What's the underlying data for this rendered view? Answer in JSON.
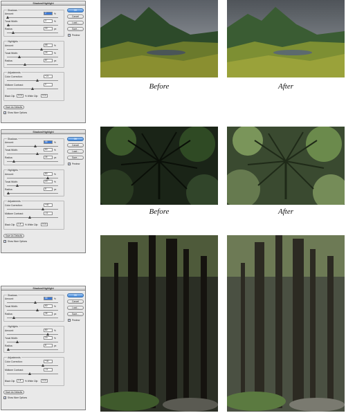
{
  "dialogs": [
    {
      "title": "Shadow/Highlight",
      "shadows": {
        "heading": "Shadows",
        "amount": {
          "label": "Amount:",
          "value": "2",
          "unit": "%",
          "level": 0.02
        },
        "tonal_width": {
          "label": "Tonal Width:",
          "value": "3",
          "unit": "%",
          "level": 0.03
        },
        "radius": {
          "label": "Radius:",
          "value": "30",
          "unit": "px",
          "level": 0.12
        }
      },
      "highlights": {
        "heading": "Highlights",
        "amount": {
          "label": "Amount:",
          "value": "68",
          "unit": "%",
          "level": 0.68
        },
        "tonal_width": {
          "label": "Tonal Width:",
          "value": "24",
          "unit": "%",
          "level": 0.24
        },
        "radius": {
          "label": "Radius:",
          "value": "87",
          "unit": "px",
          "level": 0.35
        }
      },
      "adjustments": {
        "heading": "Adjustments",
        "color_correction": {
          "label": "Color Correction:",
          "value": "+21",
          "level": 0.6
        },
        "midtone_contrast": {
          "label": "Midtone Contrast:",
          "value": "0",
          "level": 0.5
        },
        "black_clip": {
          "label": "Black Clip:",
          "value": "0.01"
        },
        "white_clip": {
          "label": "% White Clip:",
          "value": "0.01"
        }
      },
      "buttons": {
        "ok": "OK",
        "cancel": "Cancel",
        "load": "Load...",
        "save": "Save..."
      },
      "preview": "Preview",
      "save_defaults": "Save As Defaults",
      "show_more": "Show More Options"
    },
    {
      "title": "Shadow/Highlight",
      "shadows": {
        "heading": "Shadows",
        "amount": {
          "label": "Amount:",
          "value": "55",
          "unit": "%",
          "level": 0.55
        },
        "tonal_width": {
          "label": "Tonal Width:",
          "value": "60",
          "unit": "%",
          "level": 0.6
        },
        "radius": {
          "label": "Radius:",
          "value": "34",
          "unit": "px",
          "level": 0.14
        }
      },
      "highlights": {
        "heading": "Highlights",
        "amount": {
          "label": "Amount:",
          "value": "80",
          "unit": "%",
          "level": 0.8
        },
        "tonal_width": {
          "label": "Tonal Width:",
          "value": "20",
          "unit": "%",
          "level": 0.2
        },
        "radius": {
          "label": "Radius:",
          "value": "8",
          "unit": "px",
          "level": 0.03
        }
      },
      "adjustments": {
        "heading": "Adjustments",
        "color_correction": {
          "label": "Color Correction:",
          "value": "+40",
          "level": 0.7
        },
        "midtone_contrast": {
          "label": "Midtone Contrast:",
          "value": "-11",
          "level": 0.45
        },
        "black_clip": {
          "label": "Black Clip:",
          "value": "1.8"
        },
        "white_clip": {
          "label": "% White Clip:",
          "value": "0.01"
        }
      },
      "buttons": {
        "ok": "OK",
        "cancel": "Cancel",
        "load": "Load...",
        "save": "Save..."
      },
      "preview": "Preview",
      "save_defaults": "Save As Defaults",
      "show_more": "Show More Options"
    },
    {
      "title": "Shadow/Highlight",
      "shadows": {
        "heading": "Shadows",
        "amount": {
          "label": "Amount:",
          "value": "55",
          "unit": "%",
          "level": 0.55
        },
        "tonal_width": {
          "label": "Tonal Width:",
          "value": "60",
          "unit": "%",
          "level": 0.6
        },
        "radius": {
          "label": "Radius:",
          "value": "34",
          "unit": "px",
          "level": 0.14
        }
      },
      "highlights": {
        "heading": "Highlights",
        "amount": {
          "label": "Amount:",
          "value": "80",
          "unit": "%",
          "level": 0.8
        },
        "tonal_width": {
          "label": "Tonal Width:",
          "value": "20",
          "unit": "%",
          "level": 0.2
        },
        "radius": {
          "label": "Radius:",
          "value": "8",
          "unit": "px",
          "level": 0.03
        }
      },
      "adjustments": {
        "heading": "Adjustments",
        "color_correction": {
          "label": "Color Correction:",
          "value": "+40",
          "level": 0.7
        },
        "midtone_contrast": {
          "label": "Midtone Contrast:",
          "value": "-11",
          "level": 0.45
        },
        "black_clip": {
          "label": "Black Clip:",
          "value": "1.8"
        },
        "white_clip": {
          "label": "% White Clip:",
          "value": "0.01"
        }
      },
      "buttons": {
        "ok": "OK",
        "cancel": "Cancel",
        "load": "Load...",
        "save": "Save..."
      },
      "preview": "Preview",
      "save_defaults": "Save As Defaults",
      "show_more": "Show More Options"
    }
  ],
  "captions": {
    "row1_before": "Before",
    "row1_after": "After",
    "row2_before": "Before",
    "row2_after": "After"
  },
  "colors": {
    "dialog_bg": "#e9e9e9",
    "ok_button": "#3d86db",
    "selected_field": "#3a79d8"
  }
}
